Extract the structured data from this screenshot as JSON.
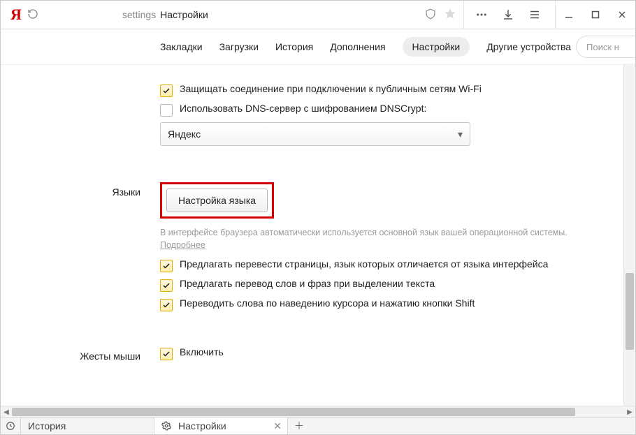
{
  "titlebar": {
    "logo": "Я",
    "address_prefix": "settings",
    "address_title": "Настройки"
  },
  "tabs": {
    "items": [
      "Закладки",
      "Загрузки",
      "История",
      "Дополнения",
      "Настройки",
      "Другие устройства"
    ],
    "active_index": 4,
    "search_placeholder": "Поиск н"
  },
  "security": {
    "protect_wifi": "Защищать соединение при подключении к публичным сетям Wi-Fi",
    "dnscrypt": "Использовать DNS-сервер с шифрованием DNSCrypt:",
    "dns_select": "Яндекс"
  },
  "languages": {
    "section": "Языки",
    "button": "Настройка языка",
    "hint1": "В интерфейсе браузера автоматически используется основной язык вашей операционной системы. ",
    "hint_more": "Подробнее",
    "opt_translate_pages": "Предлагать перевести страницы, язык которых отличается от языка интерфейса",
    "opt_translate_words": "Предлагать перевод слов и фраз при выделении текста",
    "opt_hover_shift": "Переводить слова по наведению курсора и нажатию кнопки Shift"
  },
  "gestures": {
    "section": "Жесты мыши",
    "enable": "Включить"
  },
  "bottom": {
    "history": "История",
    "settings": "Настройки"
  }
}
